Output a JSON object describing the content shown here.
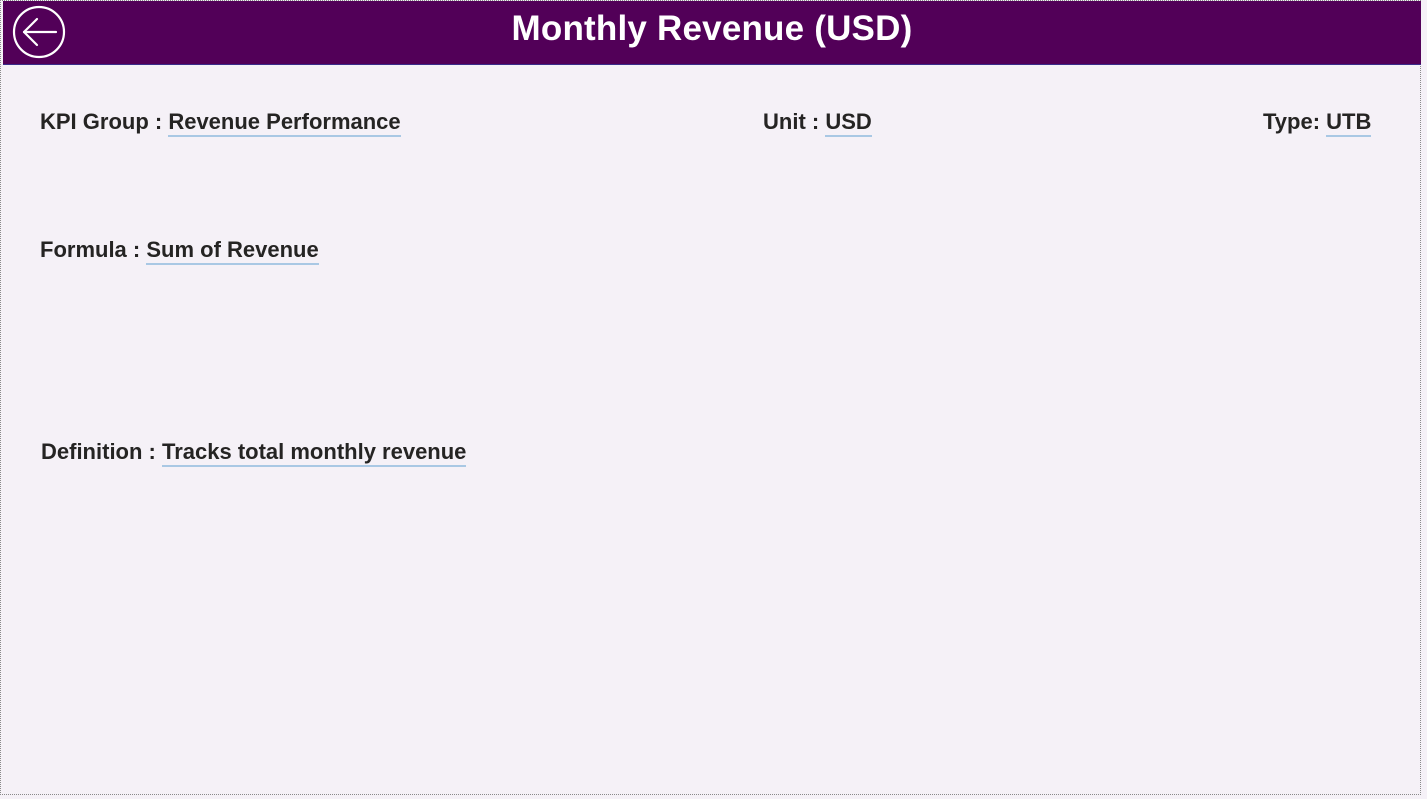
{
  "header": {
    "title": "Monthly Revenue (USD)",
    "back_icon": "arrow-left-circle-icon",
    "background_color": "#520058"
  },
  "fields": {
    "kpi_group": {
      "label": "KPI Group : ",
      "value": "Revenue Performance"
    },
    "unit": {
      "label": "Unit : ",
      "value": "USD"
    },
    "type": {
      "label": "Type: ",
      "value": "UTB"
    },
    "formula": {
      "label": "Formula : ",
      "value": "Sum of Revenue"
    },
    "definition": {
      "label": "Definition : ",
      "value": "Tracks total monthly revenue"
    }
  },
  "colors": {
    "page_background": "#f5f1f7",
    "underline": "#a9c8e4",
    "text": "#252423"
  }
}
